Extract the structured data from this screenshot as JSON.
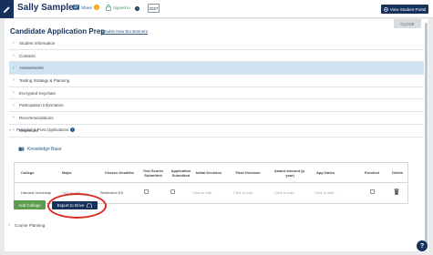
{
  "header": {
    "student_name": "Sally Sample",
    "share_label": "Share",
    "share_badge": "1",
    "signed_in_label": "Signed in",
    "help_label": "?",
    "year": "2027",
    "portal_button": "View Student Portal"
  },
  "panel": {
    "title": "Candidate Application Prep",
    "bio_link": "Enable New Bio Banners",
    "close_button": "CLOSE"
  },
  "sections": [
    {
      "label": "Student Information"
    },
    {
      "label": "Contacts"
    },
    {
      "label": "Assessments",
      "active": true
    },
    {
      "label": "Testing Strategy & Planning"
    },
    {
      "label": "Encrypted Keychain"
    },
    {
      "label": "Participation Information"
    },
    {
      "label": "Recommendations"
    },
    {
      "label": "Repertoire"
    }
  ],
  "postapps": {
    "heading": "Potential & Post Applications",
    "info": "i",
    "knowledge_base": "Knowledge Base",
    "columns": [
      "College",
      "Major",
      "Chosen Deadline",
      "Test Scores Submitted",
      "Application Submitted",
      "Initial Decision",
      "Final Decision",
      "Award Amount (p. year)",
      "App Notes",
      "Enrolled",
      "Delete"
    ],
    "row": {
      "college": "Harvard University",
      "major": "Click to edit...",
      "deadline": "Restrictive EA",
      "initial_decision": "Click to edit...",
      "final_decision": "Click to edit...",
      "award_amount": "Click to edit...",
      "app_notes": "Click to edit..."
    },
    "add_button": "Add College",
    "export_button": "Export to Drive"
  },
  "course_planning": "Course Planning",
  "help_fab": "?",
  "colors": {
    "navy": "#16325c",
    "green": "#5d9c4f",
    "active_row": "#cfe3f1",
    "annotation": "#d92c1f"
  }
}
